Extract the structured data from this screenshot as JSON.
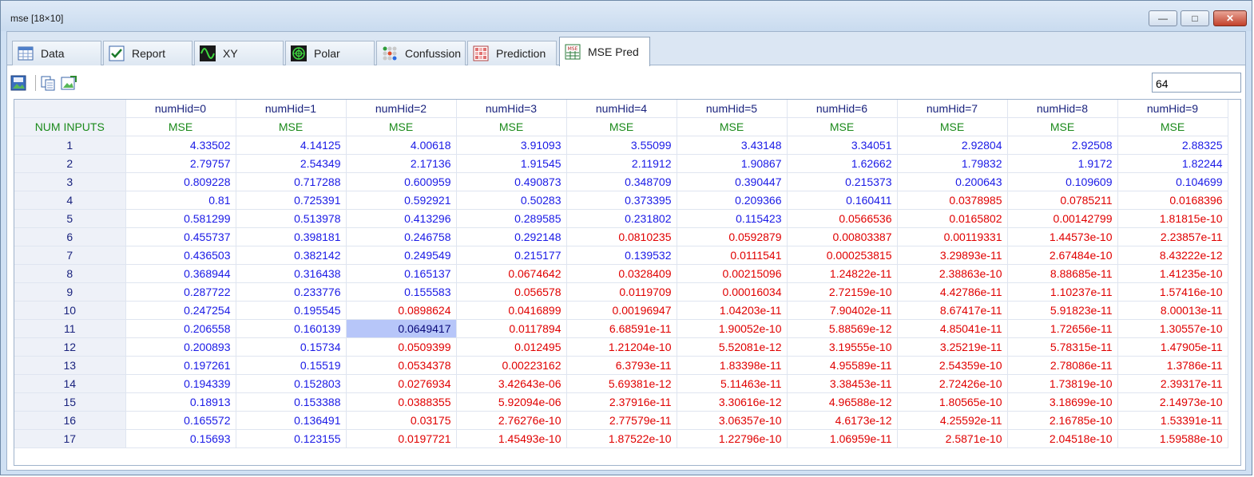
{
  "window": {
    "title": "mse [18×10]",
    "min_glyph": "—",
    "max_glyph": "□",
    "close_glyph": "✕"
  },
  "tabs": [
    {
      "label": "Data",
      "icon": "table-icon"
    },
    {
      "label": "Report",
      "icon": "checkmark-icon"
    },
    {
      "label": "XY",
      "icon": "wave-chart-icon"
    },
    {
      "label": "Polar",
      "icon": "polar-chart-icon"
    },
    {
      "label": "Confussion",
      "icon": "dots-matrix-icon"
    },
    {
      "label": "Prediction",
      "icon": "grid-chart-icon"
    },
    {
      "label": "MSE Pred",
      "icon": "mse-table-icon",
      "active": true
    }
  ],
  "toolbar": {
    "number_value": "64"
  },
  "grid": {
    "headers": [
      "numHid=0",
      "numHid=1",
      "numHid=2",
      "numHid=3",
      "numHid=4",
      "numHid=5",
      "numHid=6",
      "numHid=7",
      "numHid=8",
      "numHid=9"
    ],
    "row_header_title": "NUM INPUTS",
    "subheader": "MSE",
    "selected": {
      "row": 11,
      "col": 2
    },
    "rows": [
      {
        "n": "1",
        "values": [
          "4.33502",
          "4.14125",
          "4.00618",
          "3.91093",
          "3.55099",
          "3.43148",
          "3.34051",
          "2.92804",
          "2.92508",
          "2.88325"
        ]
      },
      {
        "n": "2",
        "values": [
          "2.79757",
          "2.54349",
          "2.17136",
          "1.91545",
          "2.11912",
          "1.90867",
          "1.62662",
          "1.79832",
          "1.9172",
          "1.82244"
        ]
      },
      {
        "n": "3",
        "values": [
          "0.809228",
          "0.717288",
          "0.600959",
          "0.490873",
          "0.348709",
          "0.390447",
          "0.215373",
          "0.200643",
          "0.109609",
          "0.104699"
        ]
      },
      {
        "n": "4",
        "values": [
          "0.81",
          "0.725391",
          "0.592921",
          "0.50283",
          "0.373395",
          "0.209366",
          "0.160411",
          "0.0378985",
          "0.0785211",
          "0.0168396"
        ]
      },
      {
        "n": "5",
        "values": [
          "0.581299",
          "0.513978",
          "0.413296",
          "0.289585",
          "0.231802",
          "0.115423",
          "0.0566536",
          "0.0165802",
          "0.00142799",
          "1.81815e-10"
        ]
      },
      {
        "n": "6",
        "values": [
          "0.455737",
          "0.398181",
          "0.246758",
          "0.292148",
          "0.0810235",
          "0.0592879",
          "0.00803387",
          "0.00119331",
          "1.44573e-10",
          "2.23857e-11"
        ]
      },
      {
        "n": "7",
        "values": [
          "0.436503",
          "0.382142",
          "0.249549",
          "0.215177",
          "0.139532",
          "0.0111541",
          "0.000253815",
          "3.29893e-11",
          "2.67484e-10",
          "8.43222e-12"
        ]
      },
      {
        "n": "8",
        "values": [
          "0.368944",
          "0.316438",
          "0.165137",
          "0.0674642",
          "0.0328409",
          "0.00215096",
          "1.24822e-11",
          "2.38863e-10",
          "8.88685e-11",
          "1.41235e-10"
        ]
      },
      {
        "n": "9",
        "values": [
          "0.287722",
          "0.233776",
          "0.155583",
          "0.056578",
          "0.0119709",
          "0.00016034",
          "2.72159e-10",
          "4.42786e-11",
          "1.10237e-11",
          "1.57416e-10"
        ]
      },
      {
        "n": "10",
        "values": [
          "0.247254",
          "0.195545",
          "0.0898624",
          "0.0416899",
          "0.00196947",
          "1.04203e-11",
          "7.90402e-11",
          "8.67417e-11",
          "5.91823e-11",
          "8.00013e-11"
        ]
      },
      {
        "n": "11",
        "values": [
          "0.206558",
          "0.160139",
          "0.0649417",
          "0.0117894",
          "6.68591e-11",
          "1.90052e-10",
          "5.88569e-12",
          "4.85041e-11",
          "1.72656e-11",
          "1.30557e-10"
        ]
      },
      {
        "n": "12",
        "values": [
          "0.200893",
          "0.15734",
          "0.0509399",
          "0.012495",
          "1.21204e-10",
          "5.52081e-12",
          "3.19555e-10",
          "3.25219e-11",
          "5.78315e-11",
          "1.47905e-11"
        ]
      },
      {
        "n": "13",
        "values": [
          "0.197261",
          "0.15519",
          "0.0534378",
          "0.00223162",
          "6.3793e-11",
          "1.83398e-11",
          "4.95589e-11",
          "2.54359e-10",
          "2.78086e-11",
          "1.3786e-11"
        ]
      },
      {
        "n": "14",
        "values": [
          "0.194339",
          "0.152803",
          "0.0276934",
          "3.42643e-06",
          "5.69381e-12",
          "5.11463e-11",
          "3.38453e-11",
          "2.72426e-10",
          "1.73819e-10",
          "2.39317e-11"
        ]
      },
      {
        "n": "15",
        "values": [
          "0.18913",
          "0.153388",
          "0.0388355",
          "5.92094e-06",
          "2.37916e-11",
          "3.30616e-12",
          "4.96588e-12",
          "1.80565e-10",
          "3.18699e-10",
          "2.14973e-10"
        ]
      },
      {
        "n": "16",
        "values": [
          "0.165572",
          "0.136491",
          "0.03175",
          "2.76276e-10",
          "2.77579e-11",
          "3.06357e-10",
          "4.6173e-12",
          "4.25592e-11",
          "2.16785e-10",
          "1.53391e-11"
        ]
      },
      {
        "n": "17",
        "values": [
          "0.15693",
          "0.123155",
          "0.0197721",
          "1.45493e-10",
          "1.87522e-10",
          "1.22796e-10",
          "1.06959e-11",
          "2.5871e-10",
          "2.04518e-10",
          "1.59588e-10"
        ]
      }
    ]
  },
  "colors": {
    "good": "#1a1ae6",
    "bad": "#e00000",
    "header": "#1a237e",
    "mse": "#1b8a1b",
    "selection": "#b7c6f9"
  }
}
